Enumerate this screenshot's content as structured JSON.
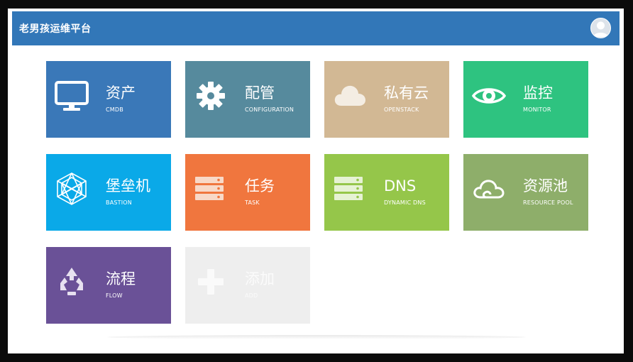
{
  "header": {
    "title": "老男孩运维平台"
  },
  "colors": {
    "header": "#3277b8",
    "cmdb": "#3a78b8",
    "config": "#568a9d",
    "openstack": "#d2b894",
    "monitor": "#2ec380",
    "bastion": "#0aa9e8",
    "task": "#f0763e",
    "dns": "#95c64a",
    "pool": "#8eae6a",
    "flow": "#6a5197",
    "add": "#eeeeee"
  },
  "tiles": [
    {
      "name": "资产",
      "sub": "CMDB",
      "icon": "monitor-icon"
    },
    {
      "name": "配管",
      "sub": "CONFIGURATION",
      "icon": "gear-icon"
    },
    {
      "name": "私有云",
      "sub": "OPENSTACK",
      "icon": "cloud-icon"
    },
    {
      "name": "监控",
      "sub": "MONITOR",
      "icon": "eye-icon"
    },
    {
      "name": "堡垒机",
      "sub": "BASTION",
      "icon": "wireframe-icon"
    },
    {
      "name": "任务",
      "sub": "TASK",
      "icon": "server-stack-icon"
    },
    {
      "name": "DNS",
      "sub": "DYNAMIC DNS",
      "icon": "server-stack-icon"
    },
    {
      "name": "资源池",
      "sub": "RESOURCE POOL",
      "icon": "cloud-outline-icon"
    },
    {
      "name": "流程",
      "sub": "FLOW",
      "icon": "recycle-icon"
    },
    {
      "name": "添加",
      "sub": "ADD",
      "icon": "plus-icon"
    }
  ]
}
